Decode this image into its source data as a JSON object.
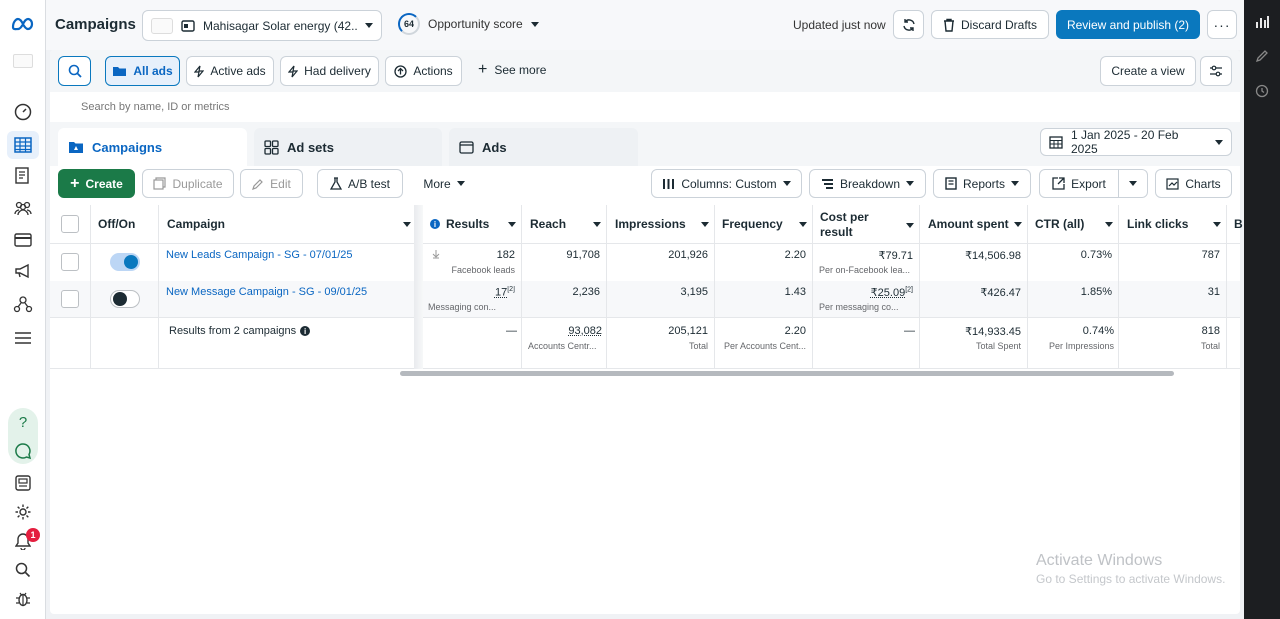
{
  "header": {
    "title": "Campaigns",
    "account": "Mahisagar Solar energy (42...",
    "opportunity_score": "64",
    "opportunity_label": "Opportunity score",
    "updated": "Updated just now",
    "discard": "Discard Drafts",
    "review": "Review and publish (2)"
  },
  "filters": {
    "all_ads": "All ads",
    "active_ads": "Active ads",
    "had_delivery": "Had delivery",
    "actions": "Actions",
    "see_more": "See more",
    "create_view": "Create a view",
    "search_placeholder": "Search by name, ID or metrics"
  },
  "tabs": {
    "campaigns": "Campaigns",
    "ad_sets": "Ad sets",
    "ads": "Ads",
    "date_range": "1 Jan 2025 - 20 Feb 2025"
  },
  "toolbar": {
    "create": "Create",
    "duplicate": "Duplicate",
    "edit": "Edit",
    "ab_test": "A/B test",
    "more": "More",
    "columns": "Columns: Custom",
    "breakdown": "Breakdown",
    "reports": "Reports",
    "export": "Export",
    "charts": "Charts"
  },
  "table": {
    "headers": {
      "offon": "Off/On",
      "campaign": "Campaign",
      "results": "Results",
      "reach": "Reach",
      "impressions": "Impressions",
      "frequency": "Frequency",
      "cost1": "Cost per",
      "cost2": "result",
      "amount_spent": "Amount spent",
      "ctr": "CTR (all)",
      "link_clicks": "Link clicks",
      "next": "B"
    },
    "rows": [
      {
        "name": "New Leads Campaign - SG - 07/01/25",
        "status": "on",
        "results": "182",
        "results_sub": "Facebook leads",
        "reach": "91,708",
        "impressions": "201,926",
        "frequency": "2.20",
        "cost": "₹79.71",
        "cost_sub": "Per on-Facebook lea...",
        "amount": "₹14,506.98",
        "ctr": "0.73%",
        "clicks": "787"
      },
      {
        "name": "New Message Campaign - SG - 09/01/25",
        "status": "off",
        "results": "17",
        "results_note": "[2]",
        "results_sub": "Messaging con...",
        "reach": "2,236",
        "impressions": "3,195",
        "frequency": "1.43",
        "cost": "₹25.09",
        "cost_note": "[2]",
        "cost_sub": "Per messaging co...",
        "amount": "₹426.47",
        "ctr": "1.85%",
        "clicks": "31"
      }
    ],
    "totals": {
      "label": "Results from 2 campaigns",
      "results": "—",
      "reach": "93,082",
      "reach_sub": "Accounts Centr...",
      "impressions": "205,121",
      "impressions_sub": "Total",
      "frequency": "2.20",
      "frequency_sub": "Per Accounts Cent...",
      "cost": "—",
      "amount": "₹14,933.45",
      "amount_sub": "Total Spent",
      "ctr": "0.74%",
      "ctr_sub": "Per Impressions",
      "clicks": "818",
      "clicks_sub": "Total"
    }
  },
  "watermark": {
    "line1": "Activate Windows",
    "line2": "Go to Settings to activate Windows."
  },
  "notifications_count": "1",
  "colors": {
    "primary": "#0a78be",
    "create": "#1b7a48",
    "link": "#0a66c2",
    "badge": "#e41e3f"
  }
}
